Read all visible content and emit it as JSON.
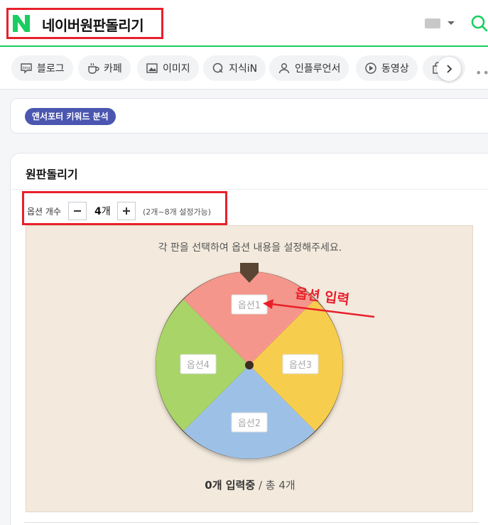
{
  "header": {
    "query": "네이버원판돌리기",
    "brand_color": "#19ce60",
    "highlight_color": "#e8202c"
  },
  "tabs": [
    {
      "label": "블로그",
      "icon": "blog-icon"
    },
    {
      "label": "카페",
      "icon": "cafe-cup-icon"
    },
    {
      "label": "이미지",
      "icon": "image-icon"
    },
    {
      "label": "지식iN",
      "icon": "knowledge-q-icon"
    },
    {
      "label": "인플루언서",
      "icon": "person-icon"
    },
    {
      "label": "동영상",
      "icon": "play-icon"
    }
  ],
  "keyword_chip": "앤서포터 키워드 분석",
  "card": {
    "title": "원판돌리기",
    "option_label": "옵션 개수",
    "count_value": "4",
    "count_unit": "개",
    "range_text": "(2개~8개 설정가능)",
    "instruction": "각 판을 선택하여 옵션 내용을 설정해주세요.",
    "status_bold": "0개 입력중",
    "status_rest": " / 총 4개"
  },
  "wheel": {
    "segments": [
      {
        "placeholder": "옵션1",
        "color": "#f4968b"
      },
      {
        "placeholder": "옵션3",
        "color": "#f7cd4d"
      },
      {
        "placeholder": "옵션2",
        "color": "#9dc1e6"
      },
      {
        "placeholder": "옵션4",
        "color": "#a8d468"
      }
    ],
    "rim_color": "#5a4535"
  },
  "annotation": {
    "text": "옵션 입력",
    "color": "#e8202c"
  }
}
